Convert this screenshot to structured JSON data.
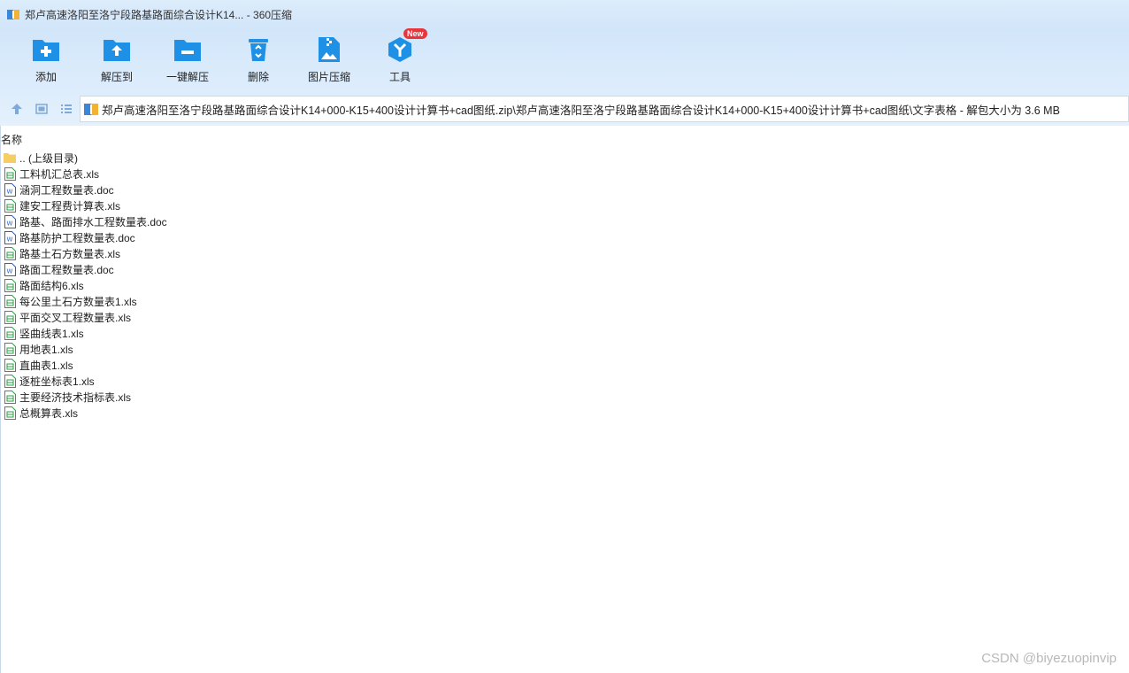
{
  "window": {
    "title": "郑卢高速洛阳至洛宁段路基路面综合设计K14... - 360压缩",
    "app_icon": "archive-app-icon"
  },
  "toolbar": {
    "add": "添加",
    "extract_to": "解压到",
    "one_click_extract": "一键解压",
    "delete": "删除",
    "image_compress": "图片压缩",
    "tools": "工具",
    "tools_badge": "New"
  },
  "address": {
    "path": "郑卢高速洛阳至洛宁段路基路面综合设计K14+000-K15+400设计计算书+cad图纸.zip\\郑卢高速洛阳至洛宁段路基路面综合设计K14+000-K15+400设计计算书+cad图纸\\文字表格 - 解包大小为 3.6 MB"
  },
  "list": {
    "column_name": "名称",
    "files": [
      {
        "name": ".. (上级目录)",
        "type": "folder"
      },
      {
        "name": "工料机汇总表.xls",
        "type": "xls"
      },
      {
        "name": "涵洞工程数量表.doc",
        "type": "doc"
      },
      {
        "name": "建安工程费计算表.xls",
        "type": "xls"
      },
      {
        "name": "路基、路面排水工程数量表.doc",
        "type": "doc"
      },
      {
        "name": "路基防护工程数量表.doc",
        "type": "doc"
      },
      {
        "name": "路基土石方数量表.xls",
        "type": "xls"
      },
      {
        "name": "路面工程数量表.doc",
        "type": "doc"
      },
      {
        "name": "路面结构6.xls",
        "type": "xls"
      },
      {
        "name": "每公里土石方数量表1.xls",
        "type": "xls"
      },
      {
        "name": "平面交叉工程数量表.xls",
        "type": "xls"
      },
      {
        "name": "竖曲线表1.xls",
        "type": "xls"
      },
      {
        "name": "用地表1.xls",
        "type": "xls"
      },
      {
        "name": "直曲表1.xls",
        "type": "xls"
      },
      {
        "name": "逐桩坐标表1.xls",
        "type": "xls"
      },
      {
        "name": "主要经济技术指标表.xls",
        "type": "xls"
      },
      {
        "name": "总概算表.xls",
        "type": "xls"
      }
    ]
  },
  "watermark": "CSDN @biyezuopinvip",
  "colors": {
    "accent": "#1e90e6",
    "xls_icon": "#2f9e44",
    "doc_icon": "#2a62c9",
    "folder_icon": "#f5cd63"
  }
}
